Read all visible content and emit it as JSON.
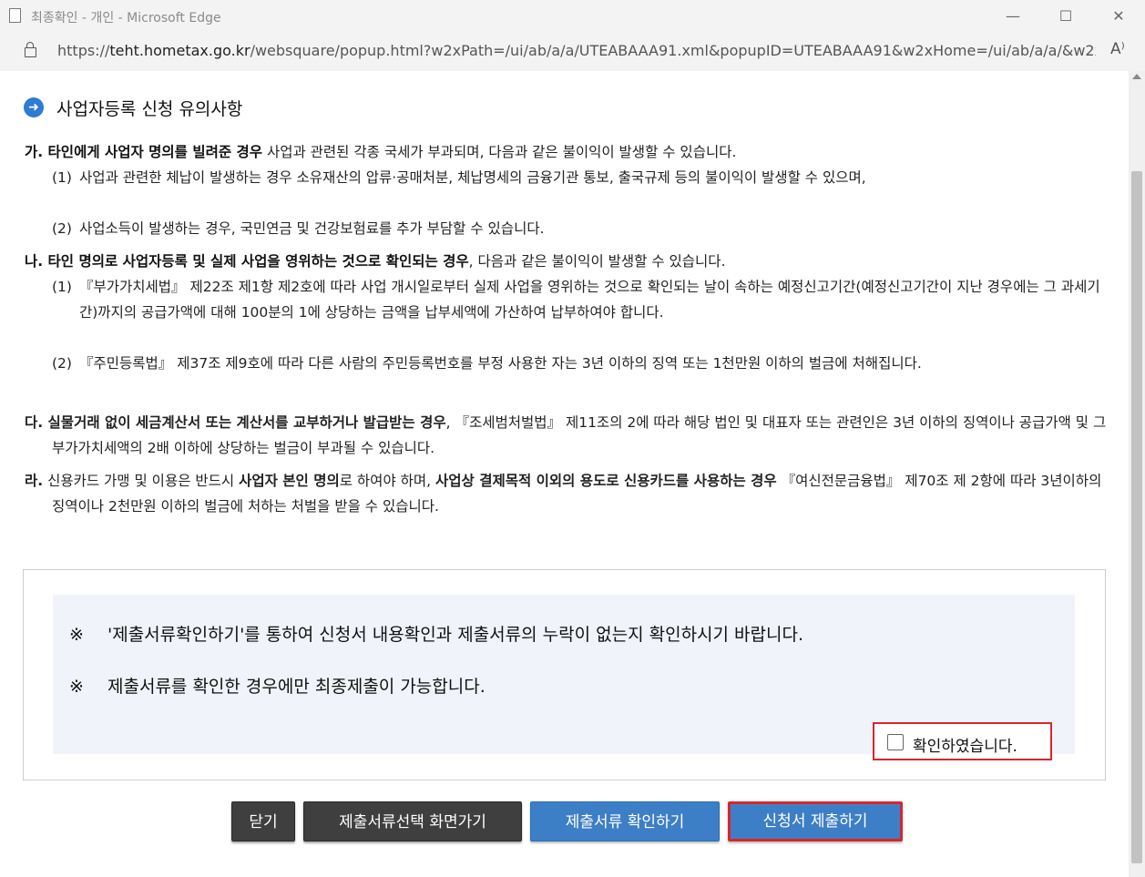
{
  "window": {
    "title": "최종확인 - 개인 - Microsoft Edge",
    "minimize_glyph": "—",
    "maximize_glyph": "☐",
    "close_glyph": "✕"
  },
  "address": {
    "url_prefix": "https://",
    "url_host": "teht.hometax.go.kr",
    "url_rest": "/websquare/popup.html?w2xPath=/ui/ab/a/a/UTEABAAA91.xml&popupID=UTEABAAA91&w2xHome=/ui/ab/a/a/&w2x...",
    "read_aloud_glyph": "A⁾"
  },
  "section": {
    "icon": "arrow-right-circle-icon",
    "title": "사업자등록 신청 유의사항"
  },
  "items": {
    "ga": {
      "head_bold": "가. 타인에게 사업자 명의를 빌려준 경우",
      "head_rest": " 사업과 관련된 각종 국세가 부과되며, 다음과 같은 불이익이 발생할 수 있습니다.",
      "sub1_num": "(1)",
      "sub1_text": "사업과 관련한 체납이 발생하는 경우 소유재산의 압류·공매처분, 체납명세의 금융기관 통보, 출국규제 등의 불이익이 발생할 수 있으며,",
      "sub2_num": "(2)",
      "sub2_text": "사업소득이 발생하는 경우, 국민연금 및 건강보험료를 추가 부담할 수 있습니다."
    },
    "na": {
      "head_bold": "나. 타인 명의로 사업자등록 및 실제 사업을 영위하는 것으로 확인되는 경우",
      "head_rest": ", 다음과 같은 불이익이 발생할 수 있습니다.",
      "sub1_num": "(1)",
      "sub1_text": "『부가가치세법』 제22조 제1항 제2호에 따라 사업 개시일로부터 실제 사업을 영위하는 것으로 확인되는 날이 속하는 예정신고기간(예정신고기간이 지난 경우에는 그 과세기간)까지의 공급가액에 대해 100분의 1에 상당하는 금액을 납부세액에 가산하여 납부하여야 합니다.",
      "sub2_num": "(2)",
      "sub2_text": "『주민등록법』 제37조 제9호에 따라 다른 사람의 주민등록번호를 부정 사용한 자는 3년 이하의 징역 또는 1천만원 이하의 벌금에 처해집니다."
    },
    "da": {
      "head_bold": "다. 실물거래 없이 세금계산서 또는 계산서를 교부하거나 발급받는 경우",
      "head_rest": ", 『조세범처벌법』 제11조의 2에 따라 해당 법인 및 대표자 또는 관련인은 3년 이하의 징역이나 공급가액 및 그 부가가치세액의 2배 이하에 상당하는 벌금이 부과될 수 있습니다."
    },
    "ra": {
      "prefix": "라.",
      "part1": " 신용카드 가맹 및 이용은 반드시 ",
      "bold1": "사업자 본인 명의",
      "part2": "로 하여야 하며, ",
      "bold2": "사업상 결제목적 이외의 용도로 신용카드를 사용하는 경우",
      "part3": " 『여신전문금융법』 제70조 제 2항에 따라 3년이하의 징역이나 2천만원 이하의 벌금에 처하는 처벌을 받을 수 있습니다."
    }
  },
  "notice": {
    "mark": "※",
    "line1": "'제출서류확인하기'를 통하여 신청서 내용확인과 제출서류의 누락이 없는지 확인하시기 바랍니다.",
    "line2": "제출서류를 확인한 경우에만 최종제출이 가능합니다.",
    "confirm_label": "확인하였습니다.",
    "confirm_checked": false
  },
  "buttons": {
    "close": "닫기",
    "goto_doc_select": "제출서류선택 화면가기",
    "check_docs": "제출서류 확인하기",
    "submit": "신청서 제출하기"
  },
  "colors": {
    "accent_blue": "#3d7fc6",
    "dark_button": "#3f3f3f",
    "highlight_red": "#d9262c",
    "notice_bg": "#f0f4fa"
  }
}
